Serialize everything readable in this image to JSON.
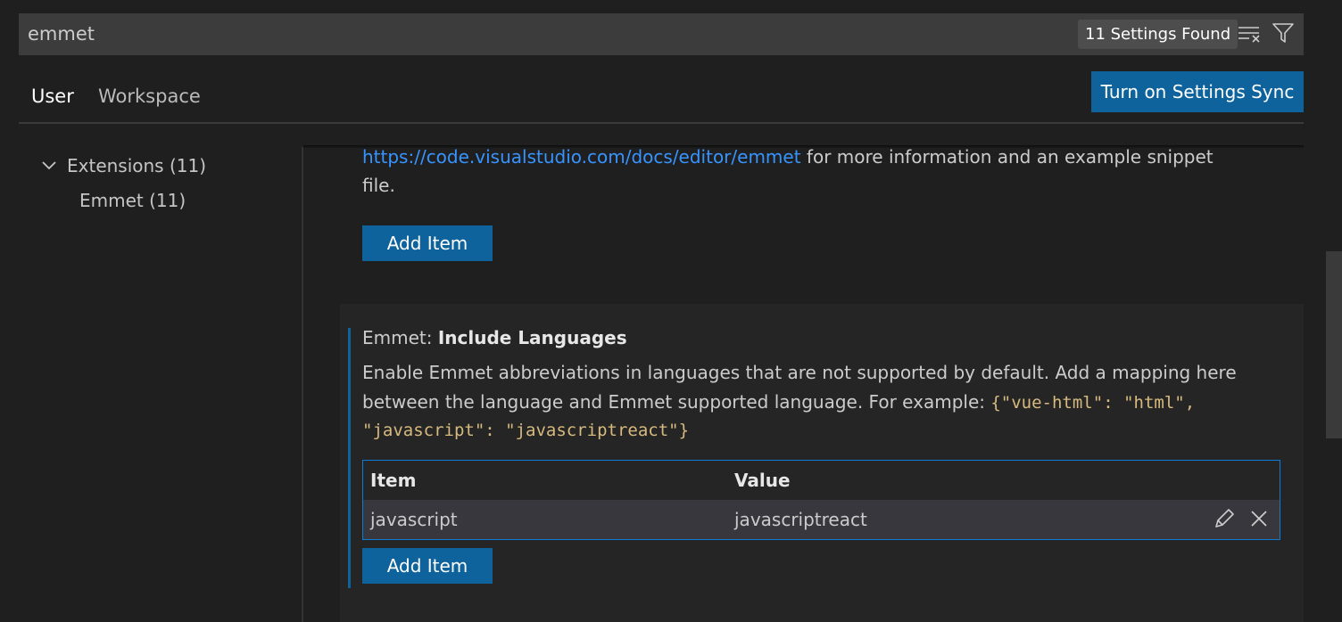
{
  "search": {
    "value": "emmet",
    "results_badge": "11 Settings Found",
    "clear_icon": "clear-filter-icon",
    "filter_icon": "filter-icon"
  },
  "tabs": [
    {
      "label": "User"
    },
    {
      "label": "Workspace"
    }
  ],
  "sync_button": "Turn on Settings Sync",
  "toc": {
    "extensions": "Extensions (11)",
    "emmet": "Emmet (11)"
  },
  "prev_setting": {
    "link": "https://code.visualstudio.com/docs/editor/emmet",
    "text_after_link": " for more information and an example snippet",
    "text_line2": "file.",
    "add_item": "Add Item"
  },
  "include_languages": {
    "category": "Emmet: ",
    "name": "Include Languages",
    "desc_line1": "Enable Emmet abbreviations in languages that are not supported by default. Add a mapping here",
    "desc_line2": "between the language and Emmet supported language. For example: ",
    "code_line2": "{\"vue-html\": \"html\",",
    "code_line3": "\"javascript\": \"javascriptreact\"}",
    "table": {
      "headers": [
        "Item",
        "Value"
      ],
      "rows": [
        {
          "item": "javascript",
          "value": "javascriptreact"
        }
      ]
    },
    "add_item": "Add Item"
  }
}
